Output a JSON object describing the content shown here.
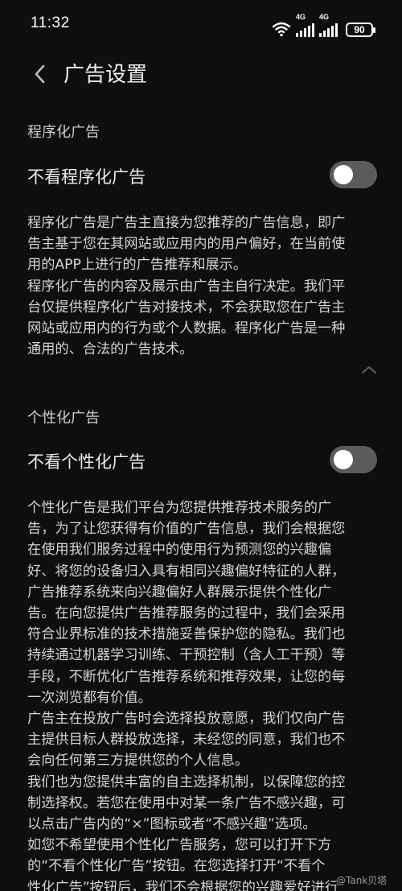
{
  "status_bar": {
    "time": "11:32",
    "network1": "4G",
    "network2": "4G",
    "battery": "90"
  },
  "header": {
    "title": "广告设置"
  },
  "programmatic": {
    "section_title": "程序化广告",
    "toggle_label": "不看程序化广告",
    "toggle_on": false,
    "description_lines": [
      "程序化广告是广告主直接为您推荐的广告信息，即广",
      "告主基于您在其网站或应用内的用户偏好，在当前使",
      "用的APP上进行的广告推荐和展示。",
      "程序化广告的内容及展示由广告主自行决定。我们平",
      "台仅提供程序化广告对接技术，不会获取您在广告主",
      "网站或应用内的行为或个人数据。程序化广告是一种",
      "通用的、合法的广告技术。"
    ]
  },
  "personalized": {
    "section_title": "个性化广告",
    "toggle_label": "不看个性化广告",
    "toggle_on": false,
    "description_lines": [
      "个性化广告是我们平台为您提供推荐技术服务的广",
      "告，为了让您获得有价值的广告信息，我们会根据您",
      "在使用我们服务过程中的使用行为预测您的兴趣偏",
      "好、将您的设备归入具有相同兴趣偏好特征的人群，",
      "广告推荐系统来向兴趣偏好人群展示提供个性化广",
      "告。在向您提供广告推荐服务的过程中，我们会采用",
      "符合业界标准的技术措施妥善保护您的隐私。我们也",
      "持续通过机器学习训练、干预控制（含人工干预）等",
      "手段，不断优化广告推荐系统和推荐效果，让您的每",
      "一次浏览都有价值。",
      "广告主在投放广告时会选择投放意愿，我们仅向广告",
      "主提供目标人群投放选择，未经您的同意，我们也不",
      "会向任何第三方提供您的个人信息。",
      "我们也为您提供丰富的自主选择机制，以保障您的控",
      "制选择权。若您在使用中对某一条广告不感兴趣，可",
      "以点击广告内的“×”图标或者“不感兴趣”选项。",
      "如您不希望使用个性化广告服务，您可以打开下方",
      "的“不看个性化广告”按钮。在您选择打开“不看个",
      "性化广告”按钮后，我们不会根据您的兴趣爱好进行"
    ]
  },
  "watermark": "@Tank贝塔"
}
